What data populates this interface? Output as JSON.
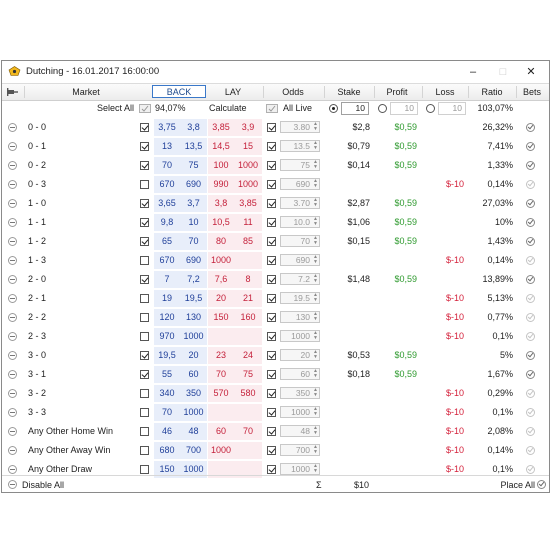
{
  "window": {
    "title": "Dutching - 16.01.2017 16:00:00",
    "minimize": "–",
    "maximize": "□",
    "close": "✕"
  },
  "header": {
    "market": "Market",
    "back": "BACK",
    "lay": "LAY",
    "odds": "Odds",
    "stake": "Stake",
    "profit": "Profit",
    "loss": "Loss",
    "ratio": "Ratio",
    "bets": "Bets"
  },
  "subheader": {
    "select_all": "Select All",
    "book_pct": "94,07%",
    "calculate_by": "Calculate by:",
    "all_live": "All Live",
    "stake_value": "10",
    "profit_value": "10",
    "loss_value": "10",
    "ratio_total": "103,07%"
  },
  "rows": [
    {
      "market": "0 - 0",
      "checked": true,
      "back1": "3,75",
      "back2": "3,8",
      "lay1": "3,85",
      "lay2": "3,9",
      "odds_checked": true,
      "odds": "3.80",
      "stake": "$2,8",
      "profit": "$0,59",
      "loss": "",
      "ratio": "26,32%",
      "bet_active": true
    },
    {
      "market": "0 - 1",
      "checked": true,
      "back1": "13",
      "back2": "13,5",
      "lay1": "14,5",
      "lay2": "15",
      "odds_checked": true,
      "odds": "13.5",
      "stake": "$0,79",
      "profit": "$0,59",
      "loss": "",
      "ratio": "7,41%",
      "bet_active": true
    },
    {
      "market": "0 - 2",
      "checked": true,
      "back1": "70",
      "back2": "75",
      "lay1": "100",
      "lay2": "1000",
      "odds_checked": true,
      "odds": "75",
      "stake": "$0,14",
      "profit": "$0,59",
      "loss": "",
      "ratio": "1,33%",
      "bet_active": true
    },
    {
      "market": "0 - 3",
      "checked": false,
      "back1": "670",
      "back2": "690",
      "lay1": "990",
      "lay2": "1000",
      "odds_checked": true,
      "odds": "690",
      "stake": "",
      "profit": "",
      "loss": "$-10",
      "ratio": "0,14%",
      "bet_active": false
    },
    {
      "market": "1 - 0",
      "checked": true,
      "back1": "3,65",
      "back2": "3,7",
      "lay1": "3,8",
      "lay2": "3,85",
      "odds_checked": true,
      "odds": "3.70",
      "stake": "$2,87",
      "profit": "$0,59",
      "loss": "",
      "ratio": "27,03%",
      "bet_active": true
    },
    {
      "market": "1 - 1",
      "checked": true,
      "back1": "9,8",
      "back2": "10",
      "lay1": "10,5",
      "lay2": "11",
      "odds_checked": true,
      "odds": "10.0",
      "stake": "$1,06",
      "profit": "$0,59",
      "loss": "",
      "ratio": "10%",
      "bet_active": true
    },
    {
      "market": "1 - 2",
      "checked": true,
      "back1": "65",
      "back2": "70",
      "lay1": "80",
      "lay2": "85",
      "odds_checked": true,
      "odds": "70",
      "stake": "$0,15",
      "profit": "$0,59",
      "loss": "",
      "ratio": "1,43%",
      "bet_active": true
    },
    {
      "market": "1 - 3",
      "checked": false,
      "back1": "670",
      "back2": "690",
      "lay1": "1000",
      "lay2": "",
      "odds_checked": true,
      "odds": "690",
      "stake": "",
      "profit": "",
      "loss": "$-10",
      "ratio": "0,14%",
      "bet_active": false
    },
    {
      "market": "2 - 0",
      "checked": true,
      "back1": "7",
      "back2": "7,2",
      "lay1": "7,6",
      "lay2": "8",
      "odds_checked": true,
      "odds": "7.2",
      "stake": "$1,48",
      "profit": "$0,59",
      "loss": "",
      "ratio": "13,89%",
      "bet_active": true
    },
    {
      "market": "2 - 1",
      "checked": false,
      "back1": "19",
      "back2": "19,5",
      "lay1": "20",
      "lay2": "21",
      "odds_checked": true,
      "odds": "19.5",
      "stake": "",
      "profit": "",
      "loss": "$-10",
      "ratio": "5,13%",
      "bet_active": false
    },
    {
      "market": "2 - 2",
      "checked": false,
      "back1": "120",
      "back2": "130",
      "lay1": "150",
      "lay2": "160",
      "odds_checked": true,
      "odds": "130",
      "stake": "",
      "profit": "",
      "loss": "$-10",
      "ratio": "0,77%",
      "bet_active": false
    },
    {
      "market": "2 - 3",
      "checked": false,
      "back1": "970",
      "back2": "1000",
      "lay1": "",
      "lay2": "",
      "odds_checked": true,
      "odds": "1000",
      "stake": "",
      "profit": "",
      "loss": "$-10",
      "ratio": "0,1%",
      "bet_active": false
    },
    {
      "market": "3 - 0",
      "checked": true,
      "back1": "19,5",
      "back2": "20",
      "lay1": "23",
      "lay2": "24",
      "odds_checked": true,
      "odds": "20",
      "stake": "$0,53",
      "profit": "$0,59",
      "loss": "",
      "ratio": "5%",
      "bet_active": true
    },
    {
      "market": "3 - 1",
      "checked": true,
      "back1": "55",
      "back2": "60",
      "lay1": "70",
      "lay2": "75",
      "odds_checked": true,
      "odds": "60",
      "stake": "$0,18",
      "profit": "$0,59",
      "loss": "",
      "ratio": "1,67%",
      "bet_active": true
    },
    {
      "market": "3 - 2",
      "checked": false,
      "back1": "340",
      "back2": "350",
      "lay1": "570",
      "lay2": "580",
      "odds_checked": true,
      "odds": "350",
      "stake": "",
      "profit": "",
      "loss": "$-10",
      "ratio": "0,29%",
      "bet_active": false
    },
    {
      "market": "3 - 3",
      "checked": false,
      "back1": "70",
      "back2": "1000",
      "lay1": "",
      "lay2": "",
      "odds_checked": true,
      "odds": "1000",
      "stake": "",
      "profit": "",
      "loss": "$-10",
      "ratio": "0,1%",
      "bet_active": false
    },
    {
      "market": "Any Other Home Win",
      "checked": false,
      "back1": "46",
      "back2": "48",
      "lay1": "60",
      "lay2": "70",
      "odds_checked": true,
      "odds": "48",
      "stake": "",
      "profit": "",
      "loss": "$-10",
      "ratio": "2,08%",
      "bet_active": false
    },
    {
      "market": "Any Other Away Win",
      "checked": false,
      "back1": "680",
      "back2": "700",
      "lay1": "1000",
      "lay2": "",
      "odds_checked": true,
      "odds": "700",
      "stake": "",
      "profit": "",
      "loss": "$-10",
      "ratio": "0,14%",
      "bet_active": false
    },
    {
      "market": "Any Other Draw",
      "checked": false,
      "back1": "150",
      "back2": "1000",
      "lay1": "",
      "lay2": "",
      "odds_checked": true,
      "odds": "1000",
      "stake": "",
      "profit": "",
      "loss": "$-10",
      "ratio": "0,1%",
      "bet_active": false
    }
  ],
  "footer": {
    "disable_all": "Disable All",
    "sigma": "Σ",
    "total_stake": "$10",
    "place_all": "Place All"
  }
}
